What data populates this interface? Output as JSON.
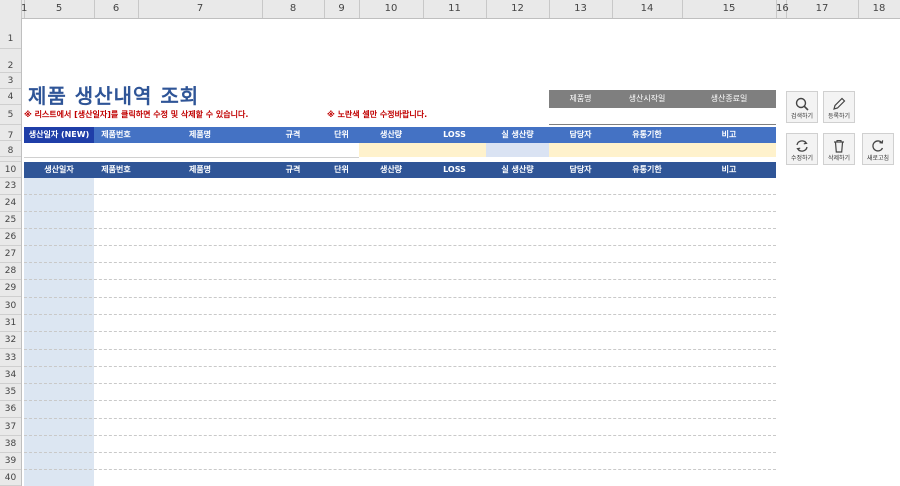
{
  "columns": [
    "1",
    "5",
    "6",
    "7",
    "8",
    "9",
    "10",
    "11",
    "12",
    "13",
    "14",
    "15",
    "16",
    "17",
    "18"
  ],
  "rows": [
    "1",
    "2",
    "3",
    "4",
    "5",
    "7",
    "8",
    "",
    "10",
    "23",
    "24",
    "25",
    "26",
    "27",
    "28",
    "29",
    "30",
    "31",
    "32",
    "33",
    "34",
    "35",
    "36",
    "37",
    "38",
    "39",
    "40"
  ],
  "title": "제품 생산내역 조회",
  "note_left": "※ 리스트에서 [생산일자]를 클릭하면 수정 및 삭제할 수 있습니다.",
  "note_right": "※ 노란색 셀만 수정바랍니다.",
  "search": {
    "product": "제품명",
    "start": "생산시작일",
    "end": "생산종료일"
  },
  "entry_header": {
    "date": "생산일자 (NEW)",
    "code": "제품번호",
    "name": "제품명",
    "spec": "규격",
    "unit": "단위",
    "qty": "생산량",
    "loss": "LOSS",
    "real": "실 생산량",
    "person": "담당자",
    "expiry": "유통기한",
    "memo": "비고"
  },
  "list_header": {
    "date": "생산일자",
    "code": "제품번호",
    "name": "제품명",
    "spec": "규격",
    "unit": "단위",
    "qty": "생산량",
    "loss": "LOSS",
    "real": "실 생산량",
    "person": "담당자",
    "expiry": "유통기한",
    "memo": "비고"
  },
  "buttons": {
    "search": "검색하기",
    "register": "등록하기",
    "edit": "수정하기",
    "delete": "삭제하기",
    "refresh": "새로고침"
  },
  "colors": {
    "title": "#2f5597",
    "entry_band": "#4472c4",
    "list_band": "#2f5597",
    "yellow_cell": "#fff2cc",
    "note_red": "#c00000"
  }
}
